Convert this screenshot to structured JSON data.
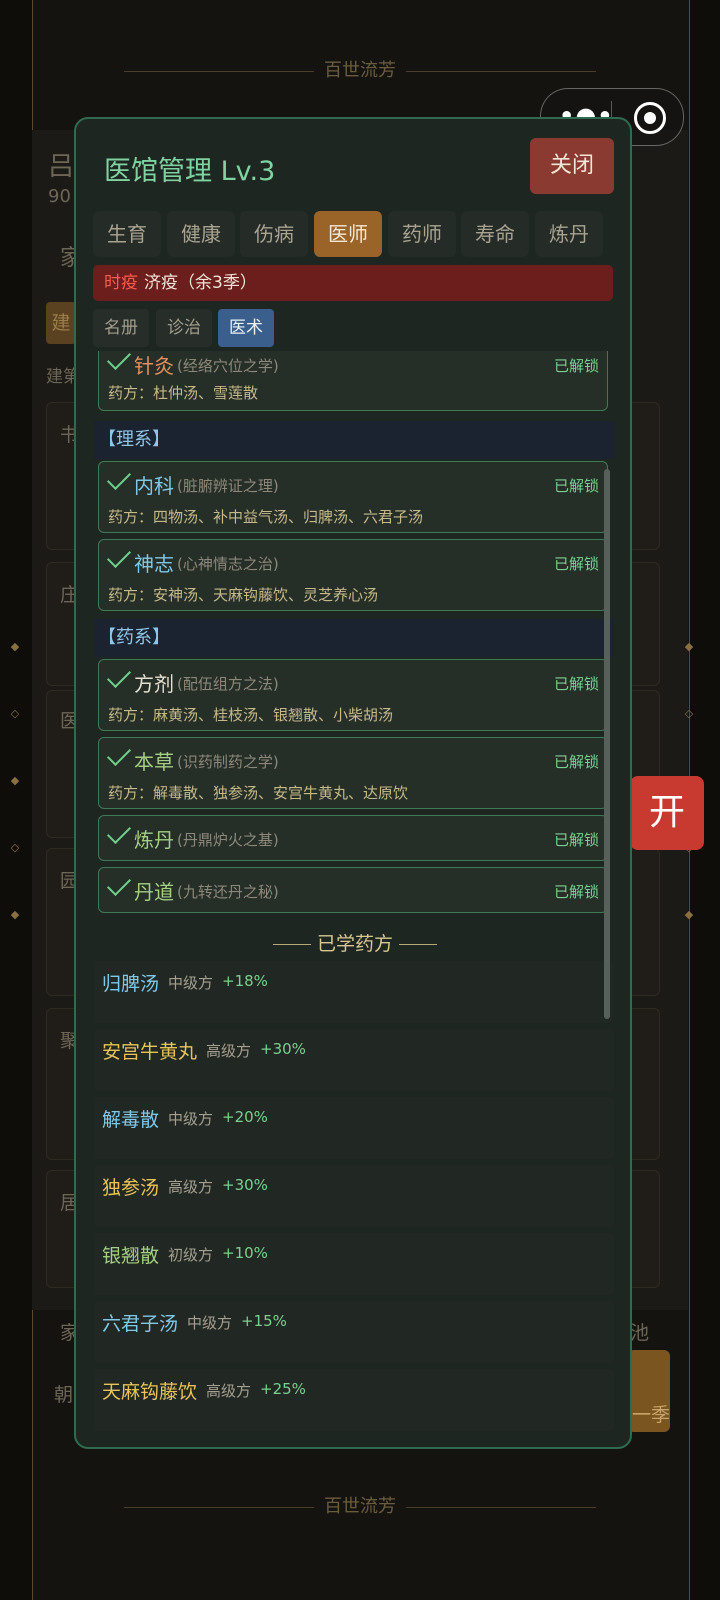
{
  "background": {
    "banner_title": "百世流芳",
    "faded_header": "吕",
    "faded_stats": "90",
    "faded_tab": "家",
    "faded_btn": "建",
    "faded_label": "建第",
    "faded_rows": [
      "书",
      "庄",
      "医",
      "园",
      "聚",
      "居"
    ],
    "faded_bottom": [
      "家",
      "朝",
      "池",
      "一季"
    ]
  },
  "capsule": {
    "more_icon": "more-icon",
    "target_icon": "target-icon"
  },
  "open_button": "开",
  "modal": {
    "title": "医馆管理 Lv.3",
    "close_label": "关闭",
    "tabs": [
      "生育",
      "健康",
      "伤病",
      "医师",
      "药师",
      "寿命",
      "炼丹"
    ],
    "active_tab": "医师",
    "plague": {
      "tag": "时疫",
      "text": "济疫（余3季）"
    },
    "subtabs": [
      "名册",
      "诊治",
      "医术"
    ],
    "active_subtab": "医术",
    "skills_top": [
      {
        "name": "针灸",
        "desc": "(经络穴位之学)",
        "status": "已解锁",
        "recipes": "药方：杜仲汤、雪莲散"
      }
    ],
    "section_li": "【理系】",
    "skills_li": [
      {
        "name": "内科",
        "desc": "(脏腑辨证之理)",
        "status": "已解锁",
        "recipes": "药方：四物汤、补中益气汤、归脾汤、六君子汤"
      },
      {
        "name": "神志",
        "desc": "(心神情志之治)",
        "status": "已解锁",
        "recipes": "药方：安神汤、天麻钩藤饮、灵芝养心汤"
      }
    ],
    "section_yao": "【药系】",
    "skills_yao": [
      {
        "name": "方剂",
        "desc": "(配伍组方之法)",
        "status": "已解锁",
        "recipes": "药方：麻黄汤、桂枝汤、银翘散、小柴胡汤"
      },
      {
        "name": "本草",
        "desc": "(识药制药之学)",
        "status": "已解锁",
        "recipes": "药方：解毒散、独参汤、安宫牛黄丸、达原饮"
      },
      {
        "name": "炼丹",
        "desc": "(丹鼎炉火之基)",
        "status": "已解锁"
      },
      {
        "name": "丹道",
        "desc": "(九转还丹之秘)",
        "status": "已解锁"
      }
    ],
    "learned_title": "已学药方",
    "learned": [
      {
        "name": "归脾汤",
        "grade": "中级方",
        "bonus": "+18%",
        "tier": "mid"
      },
      {
        "name": "安宫牛黄丸",
        "grade": "高级方",
        "bonus": "+30%",
        "tier": "high"
      },
      {
        "name": "解毒散",
        "grade": "中级方",
        "bonus": "+20%",
        "tier": "mid"
      },
      {
        "name": "独参汤",
        "grade": "高级方",
        "bonus": "+30%",
        "tier": "high"
      },
      {
        "name": "银翘散",
        "grade": "初级方",
        "bonus": "+10%",
        "tier": "low"
      },
      {
        "name": "六君子汤",
        "grade": "中级方",
        "bonus": "+15%",
        "tier": "mid"
      },
      {
        "name": "天麻钩藤饮",
        "grade": "高级方",
        "bonus": "+25%",
        "tier": "high"
      }
    ]
  }
}
